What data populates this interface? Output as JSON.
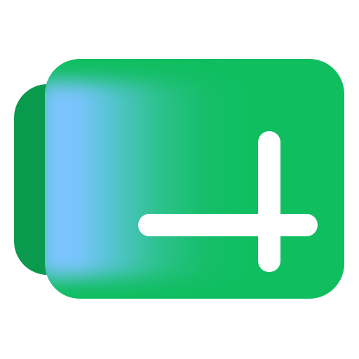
{
  "icon": {
    "name": "add-folder-icon",
    "colors": {
      "background": "#ffffff",
      "back_card": "#0a9a4e",
      "front_card": "#10be60",
      "glow": "#7cc4ff",
      "plus": "#ffffff"
    }
  }
}
